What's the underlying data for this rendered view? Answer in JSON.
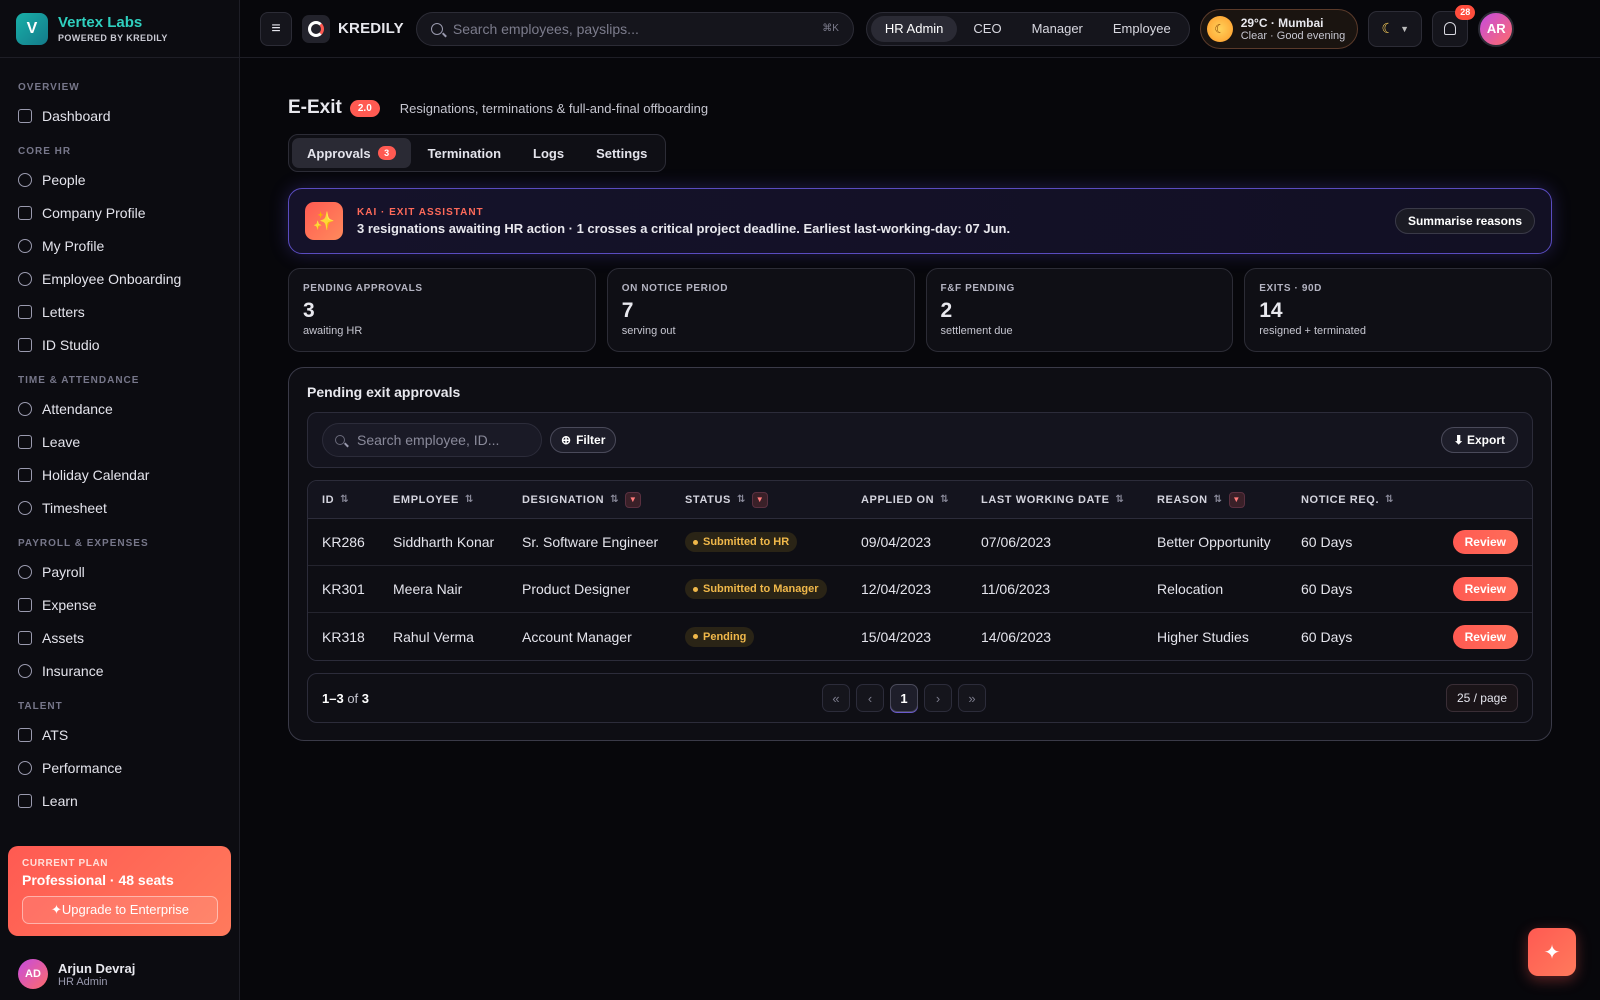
{
  "brand": {
    "logo_letter": "V",
    "name": "Vertex Labs",
    "tagline": "POWERED BY KREDILY"
  },
  "sidebar": {
    "sections": [
      {
        "label": "OVERVIEW",
        "items": [
          "Dashboard"
        ]
      },
      {
        "label": "CORE HR",
        "items": [
          "People",
          "Company Profile",
          "My Profile",
          "Employee Onboarding",
          "Letters",
          "ID Studio"
        ]
      },
      {
        "label": "TIME & ATTENDANCE",
        "items": [
          "Attendance",
          "Leave",
          "Holiday Calendar",
          "Timesheet"
        ]
      },
      {
        "label": "PAYROLL & EXPENSES",
        "items": [
          "Payroll",
          "Expense",
          "Assets",
          "Insurance"
        ]
      },
      {
        "label": "TALENT",
        "items": [
          "ATS",
          "Performance",
          "Learn"
        ]
      }
    ],
    "plan": {
      "label": "CURRENT PLAN",
      "name": "Professional · 48 seats",
      "upgrade_label": "✦Upgrade to Enterprise"
    },
    "user": {
      "initials": "AD",
      "name": "Arjun Devraj",
      "role": "HR Admin"
    }
  },
  "header": {
    "app_name": "KREDILY",
    "search_placeholder": "Search employees, payslips...",
    "search_shortcut": "⌘K",
    "roles": [
      "HR Admin",
      "CEO",
      "Manager",
      "Employee"
    ],
    "active_role": "HR Admin",
    "weather": {
      "top": "29°C · Mumbai",
      "bottom": "Clear · Good evening"
    },
    "notifications": "28",
    "avatar_initials": "AR"
  },
  "page": {
    "title": "E-Exit",
    "version": "2.0",
    "subtitle": "Resignations, terminations & full-and-final offboarding",
    "tabs": [
      {
        "label": "Approvals",
        "badge": "3"
      },
      {
        "label": "Termination"
      },
      {
        "label": "Logs"
      },
      {
        "label": "Settings"
      }
    ]
  },
  "kai": {
    "label": "KAI · EXIT ASSISTANT",
    "message": "3 resignations awaiting HR action · 1 crosses a critical project deadline. Earliest last-working-day: 07 Jun.",
    "button": "Summarise reasons"
  },
  "stats": [
    {
      "label": "PENDING APPROVALS",
      "value": "3",
      "sub": "awaiting HR"
    },
    {
      "label": "ON NOTICE PERIOD",
      "value": "7",
      "sub": "serving out"
    },
    {
      "label": "F&F PENDING",
      "value": "2",
      "sub": "settlement due"
    },
    {
      "label": "EXITS · 90D",
      "value": "14",
      "sub": "resigned + terminated"
    }
  ],
  "approvals": {
    "title": "Pending exit approvals",
    "search_placeholder": "Search employee, ID...",
    "filter_label": "Filter",
    "export_label": "⬇ Export",
    "columns": [
      "ID",
      "EMPLOYEE",
      "DESIGNATION",
      "STATUS",
      "APPLIED ON",
      "LAST WORKING DATE",
      "REASON",
      "NOTICE REQ."
    ],
    "rows": [
      {
        "id": "KR286",
        "employee": "Siddharth Konar",
        "designation": "Sr. Software Engineer",
        "status": "Submitted to HR",
        "applied": "09/04/2023",
        "lwd": "07/06/2023",
        "reason": "Better Opportunity",
        "notice": "60 Days"
      },
      {
        "id": "KR301",
        "employee": "Meera Nair",
        "designation": "Product Designer",
        "status": "Submitted to Manager",
        "applied": "12/04/2023",
        "lwd": "11/06/2023",
        "reason": "Relocation",
        "notice": "60 Days"
      },
      {
        "id": "KR318",
        "employee": "Rahul Verma",
        "designation": "Account Manager",
        "status": "Pending",
        "applied": "15/04/2023",
        "lwd": "14/06/2023",
        "reason": "Higher Studies",
        "notice": "60 Days"
      }
    ],
    "row_action": "Review",
    "pagination": {
      "range": "1–3",
      "of_label": "of",
      "total": "3",
      "current_page": "1",
      "per_page": "25 / page"
    }
  }
}
